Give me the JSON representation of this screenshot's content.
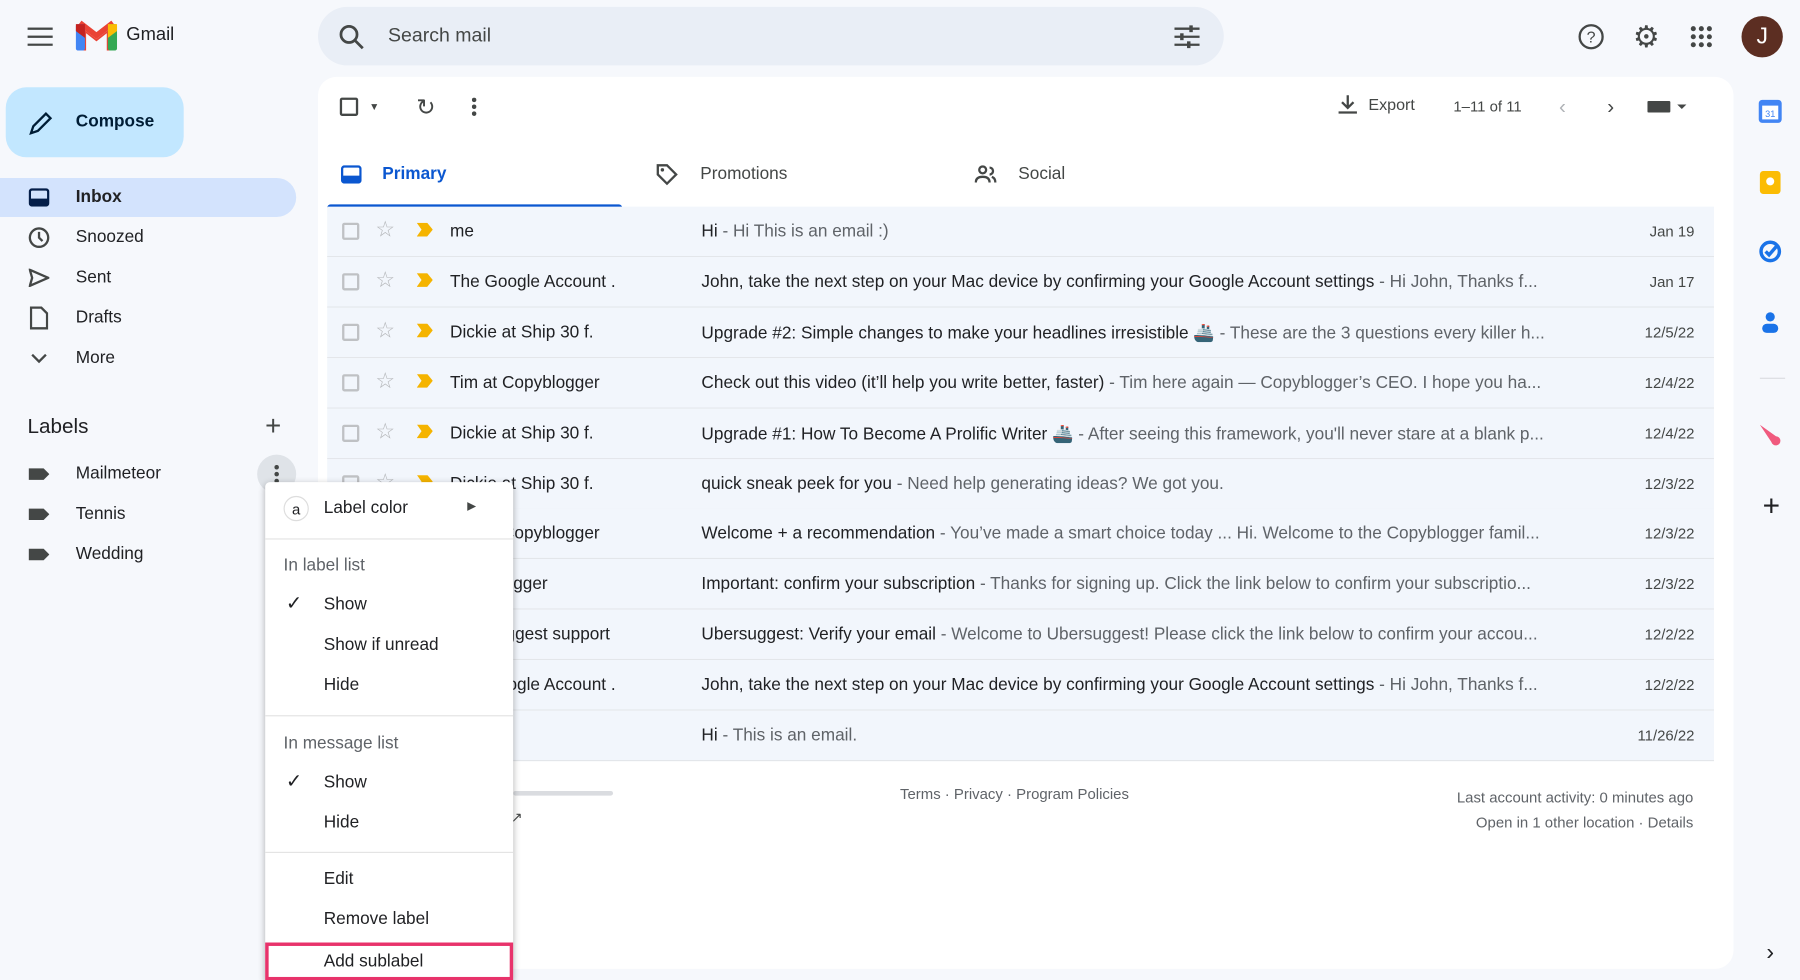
{
  "app": {
    "name": "Gmail",
    "avatar_letter": "J"
  },
  "search": {
    "placeholder": "Search mail"
  },
  "compose": {
    "label": "Compose"
  },
  "nav": [
    {
      "label": "Inbox",
      "icon": "inbox-icon",
      "active": true
    },
    {
      "label": "Snoozed",
      "icon": "clock-icon"
    },
    {
      "label": "Sent",
      "icon": "send-icon"
    },
    {
      "label": "Drafts",
      "icon": "draft-icon"
    },
    {
      "label": "More",
      "icon": "chevron-down-icon"
    }
  ],
  "labels": {
    "title": "Labels",
    "items": [
      "Mailmeteor",
      "Tennis",
      "Wedding"
    ]
  },
  "toolbar": {
    "export": "Export",
    "pagination": "1–11 of 11"
  },
  "tabs": [
    {
      "label": "Primary",
      "active": true
    },
    {
      "label": "Promotions"
    },
    {
      "label": "Social"
    }
  ],
  "emails": [
    {
      "sender": "me",
      "subject": "Hi",
      "snippet": " - Hi This is an email :)",
      "date": "Jan 19"
    },
    {
      "sender": "The Google Account .",
      "subject": "John, take the next step on your Mac device by confirming your Google Account settings",
      "snippet": " - Hi John, Thanks f...",
      "date": "Jan 17"
    },
    {
      "sender": "Dickie at Ship 30 f.",
      "subject": "Upgrade #2: Simple changes to make your headlines irresistible 🚢",
      "snippet": " - These are the 3 questions every killer h...",
      "date": "12/5/22"
    },
    {
      "sender": "Tim at Copyblogger",
      "subject": "Check out this video (it’ll help you write better, faster)",
      "snippet": " - Tim here again — Copyblogger’s CEO. I hope you ha...",
      "date": "12/4/22"
    },
    {
      "sender": "Dickie at Ship 30 f.",
      "subject": "Upgrade #1: How To Become A Prolific Writer 🚢",
      "snippet": " - After seeing this framework, you'll never stare at a blank p...",
      "date": "12/4/22"
    },
    {
      "sender": "Dickie at Ship 30 f.",
      "subject": "quick sneak peek for you",
      "snippet": " - Need help generating ideas? We got you.",
      "date": "12/3/22"
    },
    {
      "sender": "Tim at Copyblogger",
      "subject": "Welcome + a recommendation",
      "snippet": " - You’ve made a smart choice today ... Hi. Welcome to the Copyblogger famil...",
      "date": "12/3/22"
    },
    {
      "sender": "Copyblogger",
      "subject": "Important: confirm your subscription",
      "snippet": " - Thanks for signing up. Click the link below to confirm your subscriptio...",
      "date": "12/3/22"
    },
    {
      "sender": "Ubersuggest support",
      "subject": "Ubersuggest: Verify your email",
      "snippet": " - Welcome to Ubersuggest! Please click the link below to confirm your accou...",
      "date": "12/2/22"
    },
    {
      "sender": "The Google Account .",
      "subject": "John, take the next step on your Mac device by confirming your Google Account settings",
      "snippet": " - Hi John, Thanks f...",
      "date": "12/2/22"
    },
    {
      "sender": "",
      "subject": "Hi",
      "snippet": " - This is an email.",
      "date": "11/26/22"
    }
  ],
  "footer": {
    "terms": "Terms",
    "privacy": "Privacy",
    "policies": "Program Policies",
    "sep": " · ",
    "activity": "Last account activity: 0 minutes ago",
    "location": "Open in 1 other location",
    "details": "Details"
  },
  "label_menu": {
    "label_color": "Label color",
    "label_color_glyph": "a",
    "in_label_list": "In label list",
    "show": "Show",
    "show_if_unread": "Show if unread",
    "hide": "Hide",
    "in_message_list": "In message list",
    "show2": "Show",
    "hide2": "Hide",
    "edit": "Edit",
    "remove": "Remove label",
    "add_sublabel": "Add sublabel",
    "highlight_color": "#e8336b"
  },
  "colors": {
    "accent": "#0b57d0",
    "compose_bg": "#c2e7ff",
    "important": "#f5b400"
  }
}
